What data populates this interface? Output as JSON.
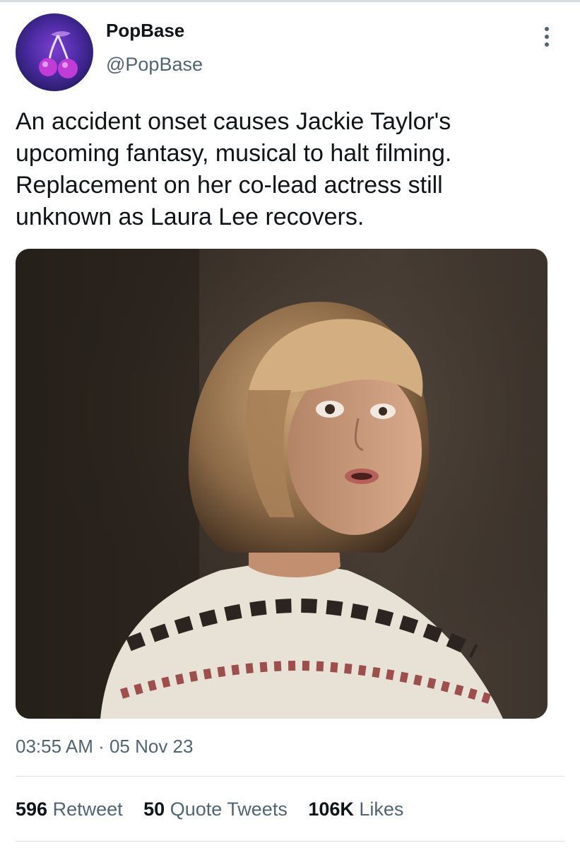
{
  "tweet": {
    "author": {
      "display_name": "PopBase",
      "handle": "@PopBase",
      "avatar_icon": "cherry-icon"
    },
    "menu_icon": "more-vertical-icon",
    "text_lines": [
      "An accident onset causes Jackie Taylor's",
      "upcoming fantasy, musical  to halt filming.",
      "Replacement on her co-lead actress still",
      "unknown as Laura Lee recovers."
    ],
    "media": {
      "type": "photo"
    },
    "timestamp": "03:55 AM · 05 Nov 23",
    "stats": {
      "retweets": {
        "count": "596",
        "label": "Retweet"
      },
      "quotes": {
        "count": "50",
        "label": "Quote Tweets"
      },
      "likes": {
        "count": "106K",
        "label": "Likes"
      }
    }
  },
  "colors": {
    "text_primary": "#0f1419",
    "text_secondary": "#536471",
    "avatar_bg": "#4a2aa0"
  }
}
